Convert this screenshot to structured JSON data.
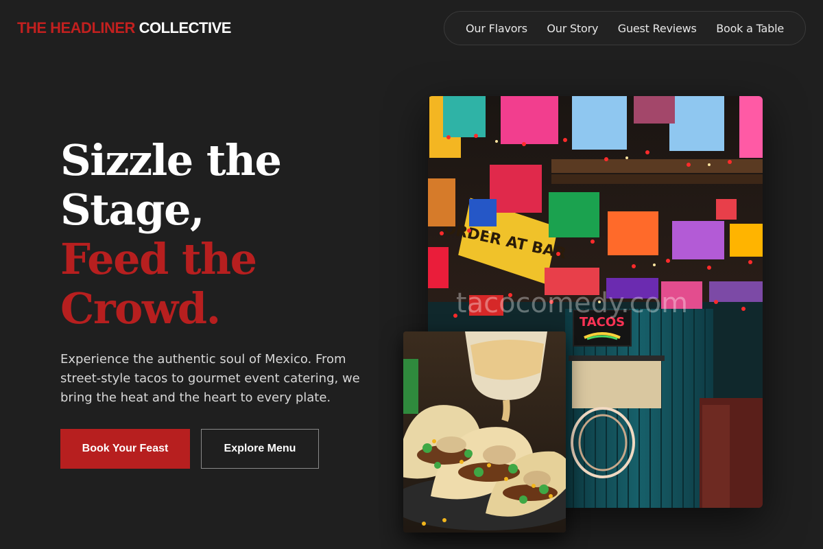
{
  "brand": {
    "name_accent": "THE HEADLINER",
    "name_rest": "COLLECTIVE",
    "accent_color": "#c1201f"
  },
  "nav": {
    "items": [
      {
        "label": "Our Flavors"
      },
      {
        "label": "Our Story"
      },
      {
        "label": "Guest Reviews"
      },
      {
        "label": "Book a Table"
      }
    ]
  },
  "hero": {
    "headline_line1": "Sizzle the",
    "headline_line2": "Stage,",
    "headline_line3": "Feed the",
    "headline_line4": "Crowd.",
    "description": "Experience the authentic soul of Mexico. From street-style tacos to gourmet event catering, we bring the heat and the heart to every plate.",
    "primary_button": "Book Your Feast",
    "secondary_button": "Explore Menu"
  },
  "images": {
    "main_alt": "Taqueria interior with colorful papel picado banners and an Order at Bar sign",
    "main_sign_text": "ORDER AT BAR",
    "main_neon_text": "TACOS",
    "watermark": "tacocomedy.com",
    "food_alt": "Tacos being drizzled with queso"
  }
}
